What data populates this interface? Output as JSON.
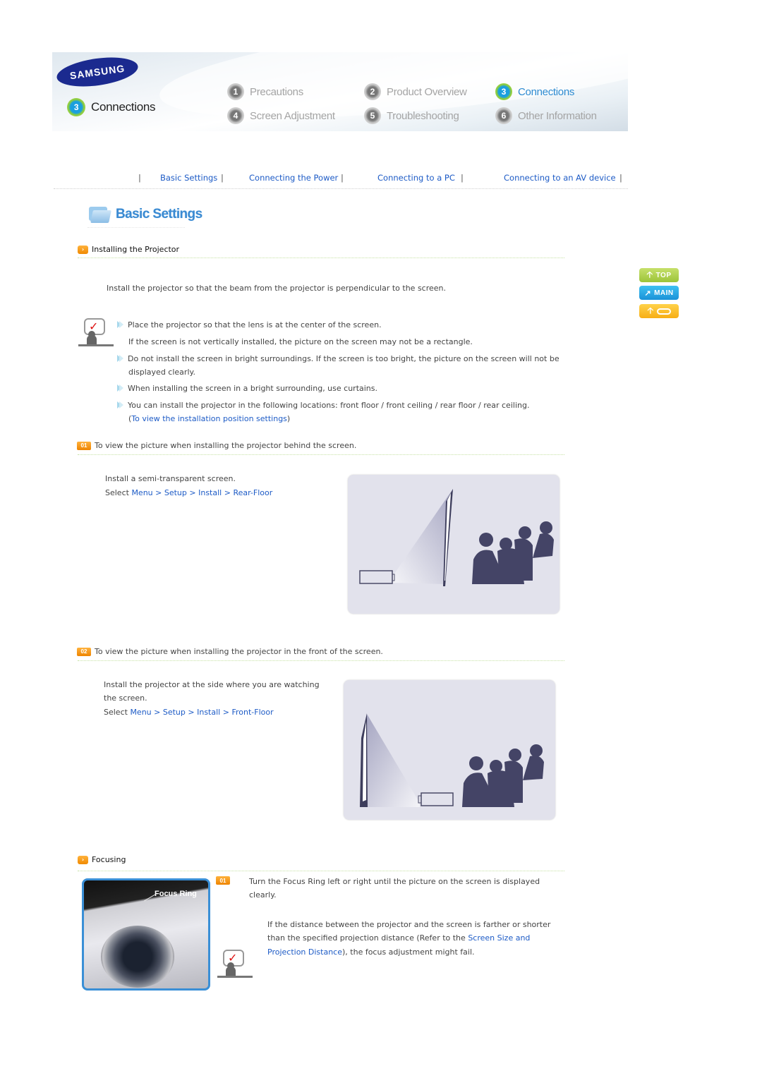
{
  "header": {
    "brand": "SAMSUNG",
    "current_section": {
      "number": "3",
      "label": "Connections"
    },
    "nav": [
      {
        "number": "1",
        "label": "Precautions",
        "active": false
      },
      {
        "number": "2",
        "label": "Product Overview",
        "active": false
      },
      {
        "number": "3",
        "label": "Connections",
        "active": true
      },
      {
        "number": "4",
        "label": "Screen Adjustment",
        "active": false
      },
      {
        "number": "5",
        "label": "Troubleshooting",
        "active": false
      },
      {
        "number": "6",
        "label": "Other Information",
        "active": false
      }
    ]
  },
  "subnav": {
    "separator": "|",
    "links": [
      "Basic Settings",
      "Connecting the Power",
      "Connecting to a PC",
      "Connecting to an AV device"
    ]
  },
  "side_buttons": {
    "top": "TOP",
    "main": "MAIN",
    "up_icon": "up-arrow-icon",
    "back_icon": "back-icon"
  },
  "page_title": "Basic Settings",
  "installing": {
    "heading": "Installing the Projector",
    "intro": "Install the projector so that the beam from the projector is perpendicular to the screen.",
    "bullets": [
      {
        "text": "Place the projector so that the lens is at the center of the screen.",
        "sub": "If the screen is not vertically installed, the picture on the screen may not be a rectangle."
      },
      {
        "line1": "Do not install the screen in bright surroundings. If the screen is too bright, the picture on the screen will not be",
        "line2": "displayed clearly."
      },
      {
        "text": "When installing the screen in a bright surrounding, use curtains."
      },
      {
        "text": "You can install the projector in the following locations:  front floor / front ceiling / rear floor / rear ceiling.",
        "link_open": "(",
        "link": "To view the installation position settings",
        "link_close": ")"
      }
    ]
  },
  "case1": {
    "badge": "01",
    "heading": "To view the picture when installing the projector behind the screen.",
    "line1": "Install a semi-transparent screen.",
    "select_prefix": "Select ",
    "path": [
      "Menu",
      "Setup",
      "Install",
      "Rear-Floor"
    ],
    "sep": " > "
  },
  "case2": {
    "badge": "02",
    "heading": "To view the picture when installing the projector in the front of the screen.",
    "line1": "Install the projector at the side where you are watching",
    "line2": "the screen.",
    "select_prefix": "Select ",
    "path": [
      "Menu",
      "Setup",
      "Install",
      "Front-Floor"
    ],
    "sep": " > "
  },
  "focusing": {
    "heading": "Focusing",
    "photo_label": "Focus Ring",
    "badge": "01",
    "step_line1": "Turn the Focus Ring left or right until the picture on the screen is displayed",
    "step_line2": "clearly.",
    "note_line1": "If the distance between the projector and the screen is farther or shorter",
    "note_line2_prefix": "than the specified projection distance (Refer to the ",
    "note_link1": "Screen Size and",
    "note_link2": "Projection Distance",
    "note_line3_suffix": "), the focus adjustment might fail."
  }
}
